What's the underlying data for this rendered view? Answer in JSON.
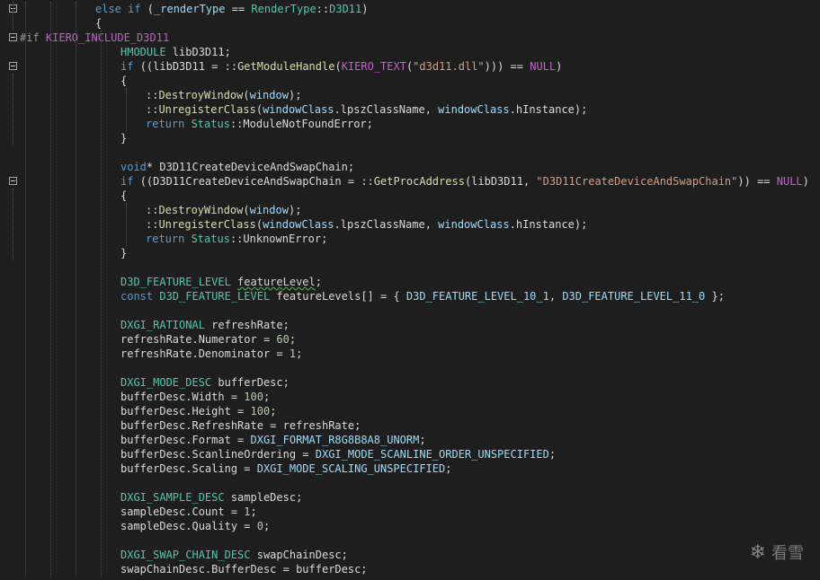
{
  "watermark": {
    "icon": "snowflake-icon",
    "text": "看雪"
  },
  "lines": [
    {
      "fold": true,
      "indent": 106,
      "tokens": [
        [
          "kw",
          "else if "
        ],
        [
          "id",
          "("
        ],
        [
          "var",
          "_renderType"
        ],
        [
          "id",
          " == "
        ],
        [
          "ty",
          "RenderType"
        ],
        [
          "id",
          "::"
        ],
        [
          "ty",
          "D3D11"
        ],
        [
          "id",
          ")"
        ]
      ]
    },
    {
      "fold": false,
      "indent": 106,
      "tokens": [
        [
          "id",
          "{"
        ]
      ]
    },
    {
      "fold": true,
      "indent": 22,
      "tokens": [
        [
          "pp",
          "#if "
        ],
        [
          "mac",
          "KIERO_INCLUDE_D3D11"
        ]
      ]
    },
    {
      "fold": false,
      "indent": 134,
      "tokens": [
        [
          "ty",
          "HMODULE "
        ],
        [
          "id",
          "libD3D11;"
        ]
      ]
    },
    {
      "fold": true,
      "indent": 134,
      "tokens": [
        [
          "kw",
          "if "
        ],
        [
          "id",
          "(("
        ],
        [
          "id",
          "libD3D11"
        ],
        [
          "id",
          " = "
        ],
        [
          "id",
          "::"
        ],
        [
          "fn",
          "GetModuleHandle"
        ],
        [
          "id",
          "("
        ],
        [
          "mac",
          "KIERO_TEXT"
        ],
        [
          "id",
          "("
        ],
        [
          "str",
          "\"d3d11.dll\""
        ],
        [
          "id",
          "))) == "
        ],
        [
          "mac",
          "NULL"
        ],
        [
          "id",
          ")"
        ]
      ]
    },
    {
      "fold": false,
      "indent": 134,
      "tokens": [
        [
          "id",
          "{"
        ]
      ]
    },
    {
      "fold": false,
      "indent": 162,
      "tokens": [
        [
          "id",
          "::"
        ],
        [
          "fn",
          "DestroyWindow"
        ],
        [
          "id",
          "("
        ],
        [
          "var",
          "window"
        ],
        [
          "id",
          ");"
        ]
      ]
    },
    {
      "fold": false,
      "indent": 162,
      "tokens": [
        [
          "id",
          "::"
        ],
        [
          "fn",
          "UnregisterClass"
        ],
        [
          "id",
          "("
        ],
        [
          "var",
          "windowClass"
        ],
        [
          "id",
          "."
        ],
        [
          "id",
          "lpszClassName, "
        ],
        [
          "var",
          "windowClass"
        ],
        [
          "id",
          ".hInstance);"
        ]
      ]
    },
    {
      "fold": false,
      "indent": 162,
      "tokens": [
        [
          "kw",
          "return "
        ],
        [
          "ty",
          "Status"
        ],
        [
          "id",
          "::"
        ],
        [
          "id",
          "ModuleNotFoundError;"
        ]
      ]
    },
    {
      "fold": false,
      "indent": 134,
      "tokens": [
        [
          "id",
          "}"
        ]
      ]
    },
    {
      "fold": false,
      "indent": 134,
      "tokens": []
    },
    {
      "fold": false,
      "indent": 134,
      "tokens": [
        [
          "kw",
          "void"
        ],
        [
          "id",
          "* D3D11CreateDeviceAndSwapChain;"
        ]
      ]
    },
    {
      "fold": true,
      "indent": 134,
      "tokens": [
        [
          "kw",
          "if "
        ],
        [
          "id",
          "((D3D11CreateDeviceAndSwapChain = ::"
        ],
        [
          "fn",
          "GetProcAddress"
        ],
        [
          "id",
          "(libD3D11, "
        ],
        [
          "str",
          "\"D3D11CreateDeviceAndSwapChain\""
        ],
        [
          "id",
          ")) == "
        ],
        [
          "mac",
          "NULL"
        ],
        [
          "id",
          ")"
        ]
      ]
    },
    {
      "fold": false,
      "indent": 134,
      "tokens": [
        [
          "id",
          "{"
        ]
      ]
    },
    {
      "fold": false,
      "indent": 162,
      "tokens": [
        [
          "id",
          "::"
        ],
        [
          "fn",
          "DestroyWindow"
        ],
        [
          "id",
          "("
        ],
        [
          "var",
          "window"
        ],
        [
          "id",
          ");"
        ]
      ]
    },
    {
      "fold": false,
      "indent": 162,
      "tokens": [
        [
          "id",
          "::"
        ],
        [
          "fn",
          "UnregisterClass"
        ],
        [
          "id",
          "("
        ],
        [
          "var",
          "windowClass"
        ],
        [
          "id",
          "."
        ],
        [
          "id",
          "lpszClassName, "
        ],
        [
          "var",
          "windowClass"
        ],
        [
          "id",
          ".hInstance);"
        ]
      ]
    },
    {
      "fold": false,
      "indent": 162,
      "tokens": [
        [
          "kw",
          "return "
        ],
        [
          "ty",
          "Status"
        ],
        [
          "id",
          "::"
        ],
        [
          "id",
          "UnknownError;"
        ]
      ]
    },
    {
      "fold": false,
      "indent": 134,
      "tokens": [
        [
          "id",
          "}"
        ]
      ]
    },
    {
      "fold": false,
      "indent": 134,
      "tokens": []
    },
    {
      "fold": false,
      "indent": 134,
      "tokens": [
        [
          "ty",
          "D3D_FEATURE_LEVEL "
        ],
        [
          "squig",
          "featureLevel"
        ],
        [
          "id",
          ";"
        ]
      ]
    },
    {
      "fold": false,
      "indent": 134,
      "tokens": [
        [
          "kw",
          "const "
        ],
        [
          "ty",
          "D3D_FEATURE_LEVEL "
        ],
        [
          "id",
          "featureLevels[] = { "
        ],
        [
          "var",
          "D3D_FEATURE_LEVEL_10_1"
        ],
        [
          "id",
          ", "
        ],
        [
          "var",
          "D3D_FEATURE_LEVEL_11_0"
        ],
        [
          "id",
          " };"
        ]
      ]
    },
    {
      "fold": false,
      "indent": 134,
      "tokens": []
    },
    {
      "fold": false,
      "indent": 134,
      "tokens": [
        [
          "ty",
          "DXGI_RATIONAL "
        ],
        [
          "id",
          "refreshRate;"
        ]
      ]
    },
    {
      "fold": false,
      "indent": 134,
      "tokens": [
        [
          "id",
          "refreshRate.Numerator = "
        ],
        [
          "num",
          "60"
        ],
        [
          "id",
          ";"
        ]
      ]
    },
    {
      "fold": false,
      "indent": 134,
      "tokens": [
        [
          "id",
          "refreshRate.Denominator = "
        ],
        [
          "num",
          "1"
        ],
        [
          "id",
          ";"
        ]
      ]
    },
    {
      "fold": false,
      "indent": 134,
      "tokens": []
    },
    {
      "fold": false,
      "indent": 134,
      "tokens": [
        [
          "ty",
          "DXGI_MODE_DESC "
        ],
        [
          "id",
          "bufferDesc;"
        ]
      ]
    },
    {
      "fold": false,
      "indent": 134,
      "tokens": [
        [
          "id",
          "bufferDesc.Width = "
        ],
        [
          "num",
          "100"
        ],
        [
          "id",
          ";"
        ]
      ]
    },
    {
      "fold": false,
      "indent": 134,
      "tokens": [
        [
          "id",
          "bufferDesc.Height = "
        ],
        [
          "num",
          "100"
        ],
        [
          "id",
          ";"
        ]
      ]
    },
    {
      "fold": false,
      "indent": 134,
      "tokens": [
        [
          "id",
          "bufferDesc.RefreshRate = refreshRate;"
        ]
      ]
    },
    {
      "fold": false,
      "indent": 134,
      "tokens": [
        [
          "id",
          "bufferDesc.Format = "
        ],
        [
          "var",
          "DXGI_FORMAT_R8G8B8A8_UNORM"
        ],
        [
          "id",
          ";"
        ]
      ]
    },
    {
      "fold": false,
      "indent": 134,
      "tokens": [
        [
          "id",
          "bufferDesc.ScanlineOrdering = "
        ],
        [
          "var",
          "DXGI_MODE_SCANLINE_ORDER_UNSPECIFIED"
        ],
        [
          "id",
          ";"
        ]
      ]
    },
    {
      "fold": false,
      "indent": 134,
      "tokens": [
        [
          "id",
          "bufferDesc.Scaling = "
        ],
        [
          "var",
          "DXGI_MODE_SCALING_UNSPECIFIED"
        ],
        [
          "id",
          ";"
        ]
      ]
    },
    {
      "fold": false,
      "indent": 134,
      "tokens": []
    },
    {
      "fold": false,
      "indent": 134,
      "tokens": [
        [
          "ty",
          "DXGI_SAMPLE_DESC "
        ],
        [
          "id",
          "sampleDesc;"
        ]
      ]
    },
    {
      "fold": false,
      "indent": 134,
      "tokens": [
        [
          "id",
          "sampleDesc.Count = "
        ],
        [
          "num",
          "1"
        ],
        [
          "id",
          ";"
        ]
      ]
    },
    {
      "fold": false,
      "indent": 134,
      "tokens": [
        [
          "id",
          "sampleDesc.Quality = "
        ],
        [
          "num",
          "0"
        ],
        [
          "id",
          ";"
        ]
      ]
    },
    {
      "fold": false,
      "indent": 134,
      "tokens": []
    },
    {
      "fold": false,
      "indent": 134,
      "tokens": [
        [
          "ty",
          "DXGI_SWAP_CHAIN_DESC "
        ],
        [
          "id",
          "swapChainDesc;"
        ]
      ]
    },
    {
      "fold": false,
      "indent": 134,
      "tokens": [
        [
          "id",
          "swapChainDesc.BufferDesc = bufferDesc;"
        ]
      ]
    }
  ]
}
